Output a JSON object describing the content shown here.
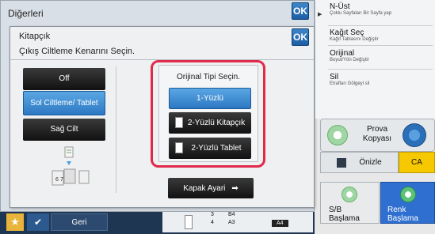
{
  "background_window": {
    "title": "Diğerleri",
    "ok_label": "OK"
  },
  "dialog": {
    "title": "Kitapçık",
    "ok_label": "OK",
    "prompt": "Çıkış Ciltleme Kenarını Seçin.",
    "binding_options": [
      {
        "label": "Off",
        "selected": false
      },
      {
        "label": "Sol Ciltleme/ Tablet",
        "selected": true
      },
      {
        "label": "Sağ Cilt",
        "selected": false
      }
    ],
    "original_type": {
      "title": "Orijinal Tipi Seçin.",
      "options": [
        {
          "label": "1-Yüzlü",
          "selected": true,
          "icon": "none"
        },
        {
          "label": "2-Yüzlü Kitapçık",
          "selected": false,
          "icon": "booklet-page-icon"
        },
        {
          "label": "2-Yüzlü Tablet",
          "selected": false,
          "icon": "tablet-page-icon"
        }
      ]
    },
    "cover_button": "Kapak Ayari"
  },
  "right_panel": {
    "items": [
      {
        "title": "N-Üst",
        "subtitle": "Çoklu Sayfaları Bir Sayfa yap"
      },
      {
        "title": "Kağıt Seç",
        "subtitle": "Kağıt Tablasını Değiştir"
      },
      {
        "title": "Orijinal",
        "subtitle": "Boyut/Yön Değiştir"
      },
      {
        "title": "Sil",
        "subtitle": "Etrafları Gölgeyi sil"
      }
    ],
    "proof_copy": "Prova Kopyası",
    "preview": "Önizle",
    "ca": "CA",
    "bw_start": {
      "line1": "S/B",
      "line2": "Başlama"
    },
    "color_start": {
      "line1": "Renk",
      "line2": "Başlama"
    }
  },
  "bottom_bar": {
    "back_label": "Geri",
    "trays": [
      "3",
      "B4",
      "4",
      "A3",
      "A4"
    ]
  },
  "colors": {
    "accent": "#2d78c2",
    "highlight": "#e02a4a",
    "ca": "#f5c800",
    "color_start": "#2f6fd0"
  }
}
